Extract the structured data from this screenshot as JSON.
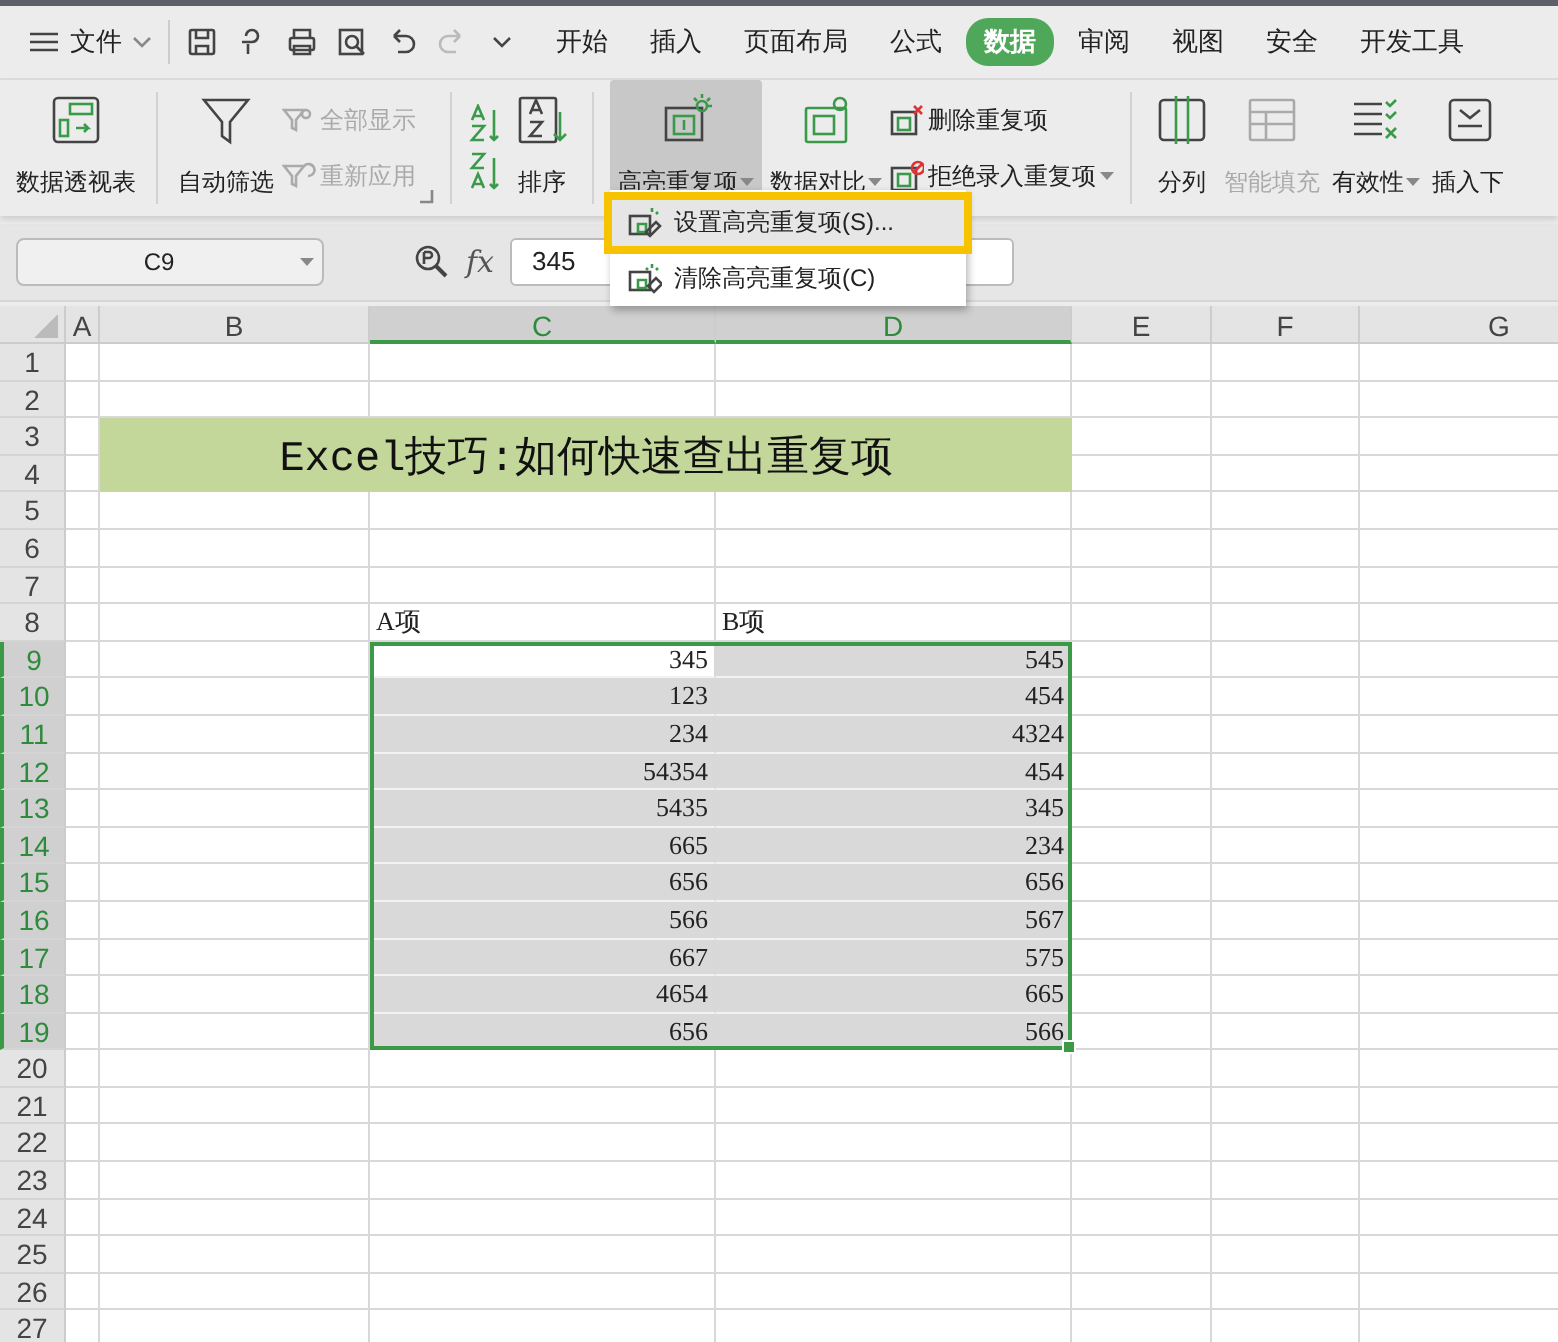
{
  "menu_bar": {
    "file_menu": "文件",
    "tabs": [
      {
        "label": "开始",
        "selected": false
      },
      {
        "label": "插入",
        "selected": false
      },
      {
        "label": "页面布局",
        "selected": false
      },
      {
        "label": "公式",
        "selected": false
      },
      {
        "label": "数据",
        "selected": true
      },
      {
        "label": "审阅",
        "selected": false
      },
      {
        "label": "视图",
        "selected": false
      },
      {
        "label": "安全",
        "selected": false
      },
      {
        "label": "开发工具",
        "selected": false
      }
    ]
  },
  "ribbon": {
    "groups": [
      {
        "items": [
          {
            "kind": "large",
            "label": "数据透视表",
            "disabled": false,
            "pressed": false,
            "dropdown": false
          }
        ]
      },
      {
        "launcher": true,
        "items": [
          {
            "kind": "large",
            "label": "自动筛选",
            "disabled": false,
            "pressed": false,
            "dropdown": false
          },
          {
            "kind": "stack",
            "entries": [
              {
                "label": "全部显示",
                "disabled": true,
                "dropdown": false
              },
              {
                "label": "重新应用",
                "disabled": true,
                "dropdown": false
              }
            ]
          }
        ]
      },
      {
        "items": [
          {
            "kind": "icons"
          },
          {
            "kind": "large",
            "label": "排序",
            "disabled": false,
            "pressed": false,
            "dropdown": false
          }
        ]
      },
      {
        "items": [
          {
            "kind": "large",
            "label": "高亮重复项",
            "disabled": false,
            "pressed": true,
            "dropdown": true
          },
          {
            "kind": "large",
            "label": "数据对比",
            "disabled": false,
            "pressed": false,
            "dropdown": true
          },
          {
            "kind": "stack",
            "entries": [
              {
                "label": "删除重复项",
                "disabled": false,
                "dropdown": false
              },
              {
                "label": "拒绝录入重复项",
                "disabled": false,
                "dropdown": true
              }
            ]
          }
        ]
      },
      {
        "items": [
          {
            "kind": "large",
            "label": "分列",
            "disabled": false,
            "pressed": false,
            "dropdown": false
          },
          {
            "kind": "large",
            "label": "智能填充",
            "disabled": true,
            "pressed": false,
            "dropdown": false
          },
          {
            "kind": "large",
            "label": "有效性",
            "disabled": false,
            "pressed": false,
            "dropdown": true
          },
          {
            "kind": "large",
            "label": "插入下",
            "disabled": false,
            "pressed": false,
            "dropdown": false
          }
        ]
      }
    ]
  },
  "dropdown_menu": {
    "items": [
      {
        "label": "设置高亮重复项(S)...",
        "highlighted": true
      },
      {
        "label": "清除高亮重复项(C)",
        "highlighted": false
      }
    ]
  },
  "formula_bar": {
    "name_box": "C9",
    "fx": "fx",
    "value": "345"
  },
  "sheet": {
    "columns": [
      {
        "label": "A",
        "selected": false
      },
      {
        "label": "B",
        "selected": false
      },
      {
        "label": "C",
        "selected": true
      },
      {
        "label": "D",
        "selected": true
      },
      {
        "label": "E",
        "selected": false
      },
      {
        "label": "F",
        "selected": false
      },
      {
        "label": "G",
        "selected": false
      }
    ],
    "banner": "Excel技巧:如何快速查出重复项",
    "rows": [
      {
        "label": "1",
        "selected": false
      },
      {
        "label": "2",
        "selected": false
      },
      {
        "label": "3",
        "selected": false
      },
      {
        "label": "4",
        "selected": false
      },
      {
        "label": "5",
        "selected": false
      },
      {
        "label": "6",
        "selected": false
      },
      {
        "label": "7",
        "selected": false
      },
      {
        "label": "8",
        "selected": false,
        "cells": [
          {
            "value": "A项",
            "selected": false
          },
          {
            "value": "B项",
            "selected": false
          }
        ]
      },
      {
        "label": "9",
        "selected": true,
        "cells": [
          {
            "value": "345",
            "selected": true,
            "active": true
          },
          {
            "value": "545",
            "selected": true,
            "active": false
          }
        ]
      },
      {
        "label": "10",
        "selected": true,
        "cells": [
          {
            "value": "123",
            "selected": true,
            "active": false
          },
          {
            "value": "454",
            "selected": true,
            "active": false
          }
        ]
      },
      {
        "label": "11",
        "selected": true,
        "cells": [
          {
            "value": "234",
            "selected": true,
            "active": false
          },
          {
            "value": "4324",
            "selected": true,
            "active": false
          }
        ]
      },
      {
        "label": "12",
        "selected": true,
        "cells": [
          {
            "value": "54354",
            "selected": true,
            "active": false
          },
          {
            "value": "454",
            "selected": true,
            "active": false
          }
        ]
      },
      {
        "label": "13",
        "selected": true,
        "cells": [
          {
            "value": "5435",
            "selected": true,
            "active": false
          },
          {
            "value": "345",
            "selected": true,
            "active": false
          }
        ]
      },
      {
        "label": "14",
        "selected": true,
        "cells": [
          {
            "value": "665",
            "selected": true,
            "active": false
          },
          {
            "value": "234",
            "selected": true,
            "active": false
          }
        ]
      },
      {
        "label": "15",
        "selected": true,
        "cells": [
          {
            "value": "656",
            "selected": true,
            "active": false
          },
          {
            "value": "656",
            "selected": true,
            "active": false
          }
        ]
      },
      {
        "label": "16",
        "selected": true,
        "cells": [
          {
            "value": "566",
            "selected": true,
            "active": false
          },
          {
            "value": "567",
            "selected": true,
            "active": false
          }
        ]
      },
      {
        "label": "17",
        "selected": true,
        "cells": [
          {
            "value": "667",
            "selected": true,
            "active": false
          },
          {
            "value": "575",
            "selected": true,
            "active": false
          }
        ]
      },
      {
        "label": "18",
        "selected": true,
        "cells": [
          {
            "value": "4654",
            "selected": true,
            "active": false
          },
          {
            "value": "665",
            "selected": true,
            "active": false
          }
        ]
      },
      {
        "label": "19",
        "selected": true,
        "cells": [
          {
            "value": "656",
            "selected": true,
            "active": false
          },
          {
            "value": "566",
            "selected": true,
            "active": false
          }
        ]
      },
      {
        "label": "20",
        "selected": false
      },
      {
        "label": "21",
        "selected": false
      },
      {
        "label": "22",
        "selected": false
      },
      {
        "label": "23",
        "selected": false
      },
      {
        "label": "24",
        "selected": false
      },
      {
        "label": "25",
        "selected": false
      },
      {
        "label": "26",
        "selected": false
      },
      {
        "label": "27",
        "selected": false
      }
    ]
  }
}
